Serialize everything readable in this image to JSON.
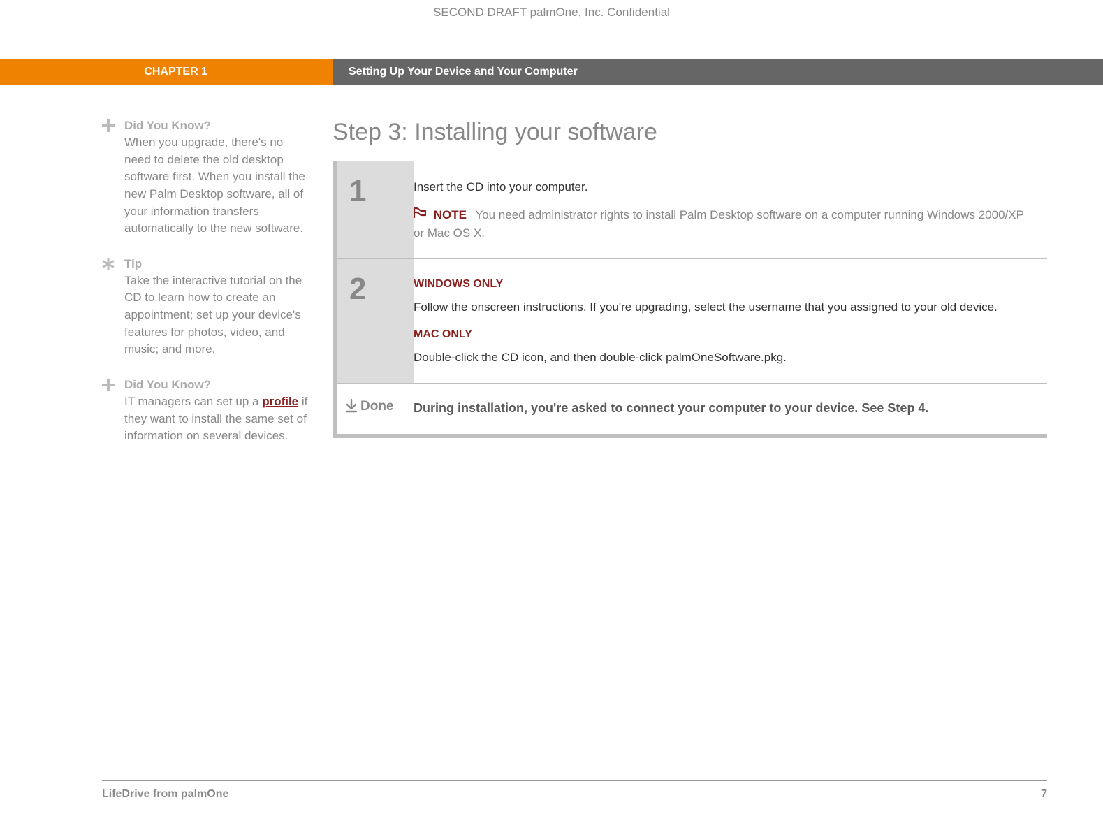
{
  "confidential": "SECOND DRAFT palmOne, Inc.  Confidential",
  "header": {
    "chapter": "CHAPTER 1",
    "title": "Setting Up Your Device and Your Computer"
  },
  "sidebar": {
    "items": [
      {
        "icon": "plus",
        "title": "Did You Know?",
        "text": "When you upgrade, there's no need to delete the old desktop software first. When you install the new Palm Desktop software, all of your information transfers automatically to the new software."
      },
      {
        "icon": "asterisk",
        "title": "Tip",
        "text": "Take the interactive tutorial on the CD to learn how to create an appointment; set up your device's features for photos, video, and music; and more."
      },
      {
        "icon": "plus",
        "title": "Did You Know?",
        "text_pre": "IT managers can set up a ",
        "link": "profile",
        "text_post": " if they want to install the same set of information on several devices."
      }
    ]
  },
  "main": {
    "heading": "Step 3: Installing your software",
    "steps": [
      {
        "num": "1",
        "line1": "Insert the CD into your computer.",
        "note_label": "NOTE",
        "note_text": "You need administrator rights to install Palm Desktop software on a computer running Windows 2000/XP or Mac OS X."
      },
      {
        "num": "2",
        "win_label": "WINDOWS ONLY",
        "win_text": "Follow the onscreen instructions. If you're upgrading, select the username that you assigned to your old device.",
        "mac_label": "MAC ONLY",
        "mac_text": "Double-click the CD icon, and then double-click palmOneSoftware.pkg."
      }
    ],
    "done": {
      "label": "Done",
      "text": "During installation, you're asked to connect your computer to your device. See Step 4."
    }
  },
  "footer": {
    "product": "LifeDrive from palmOne",
    "page": "7"
  }
}
